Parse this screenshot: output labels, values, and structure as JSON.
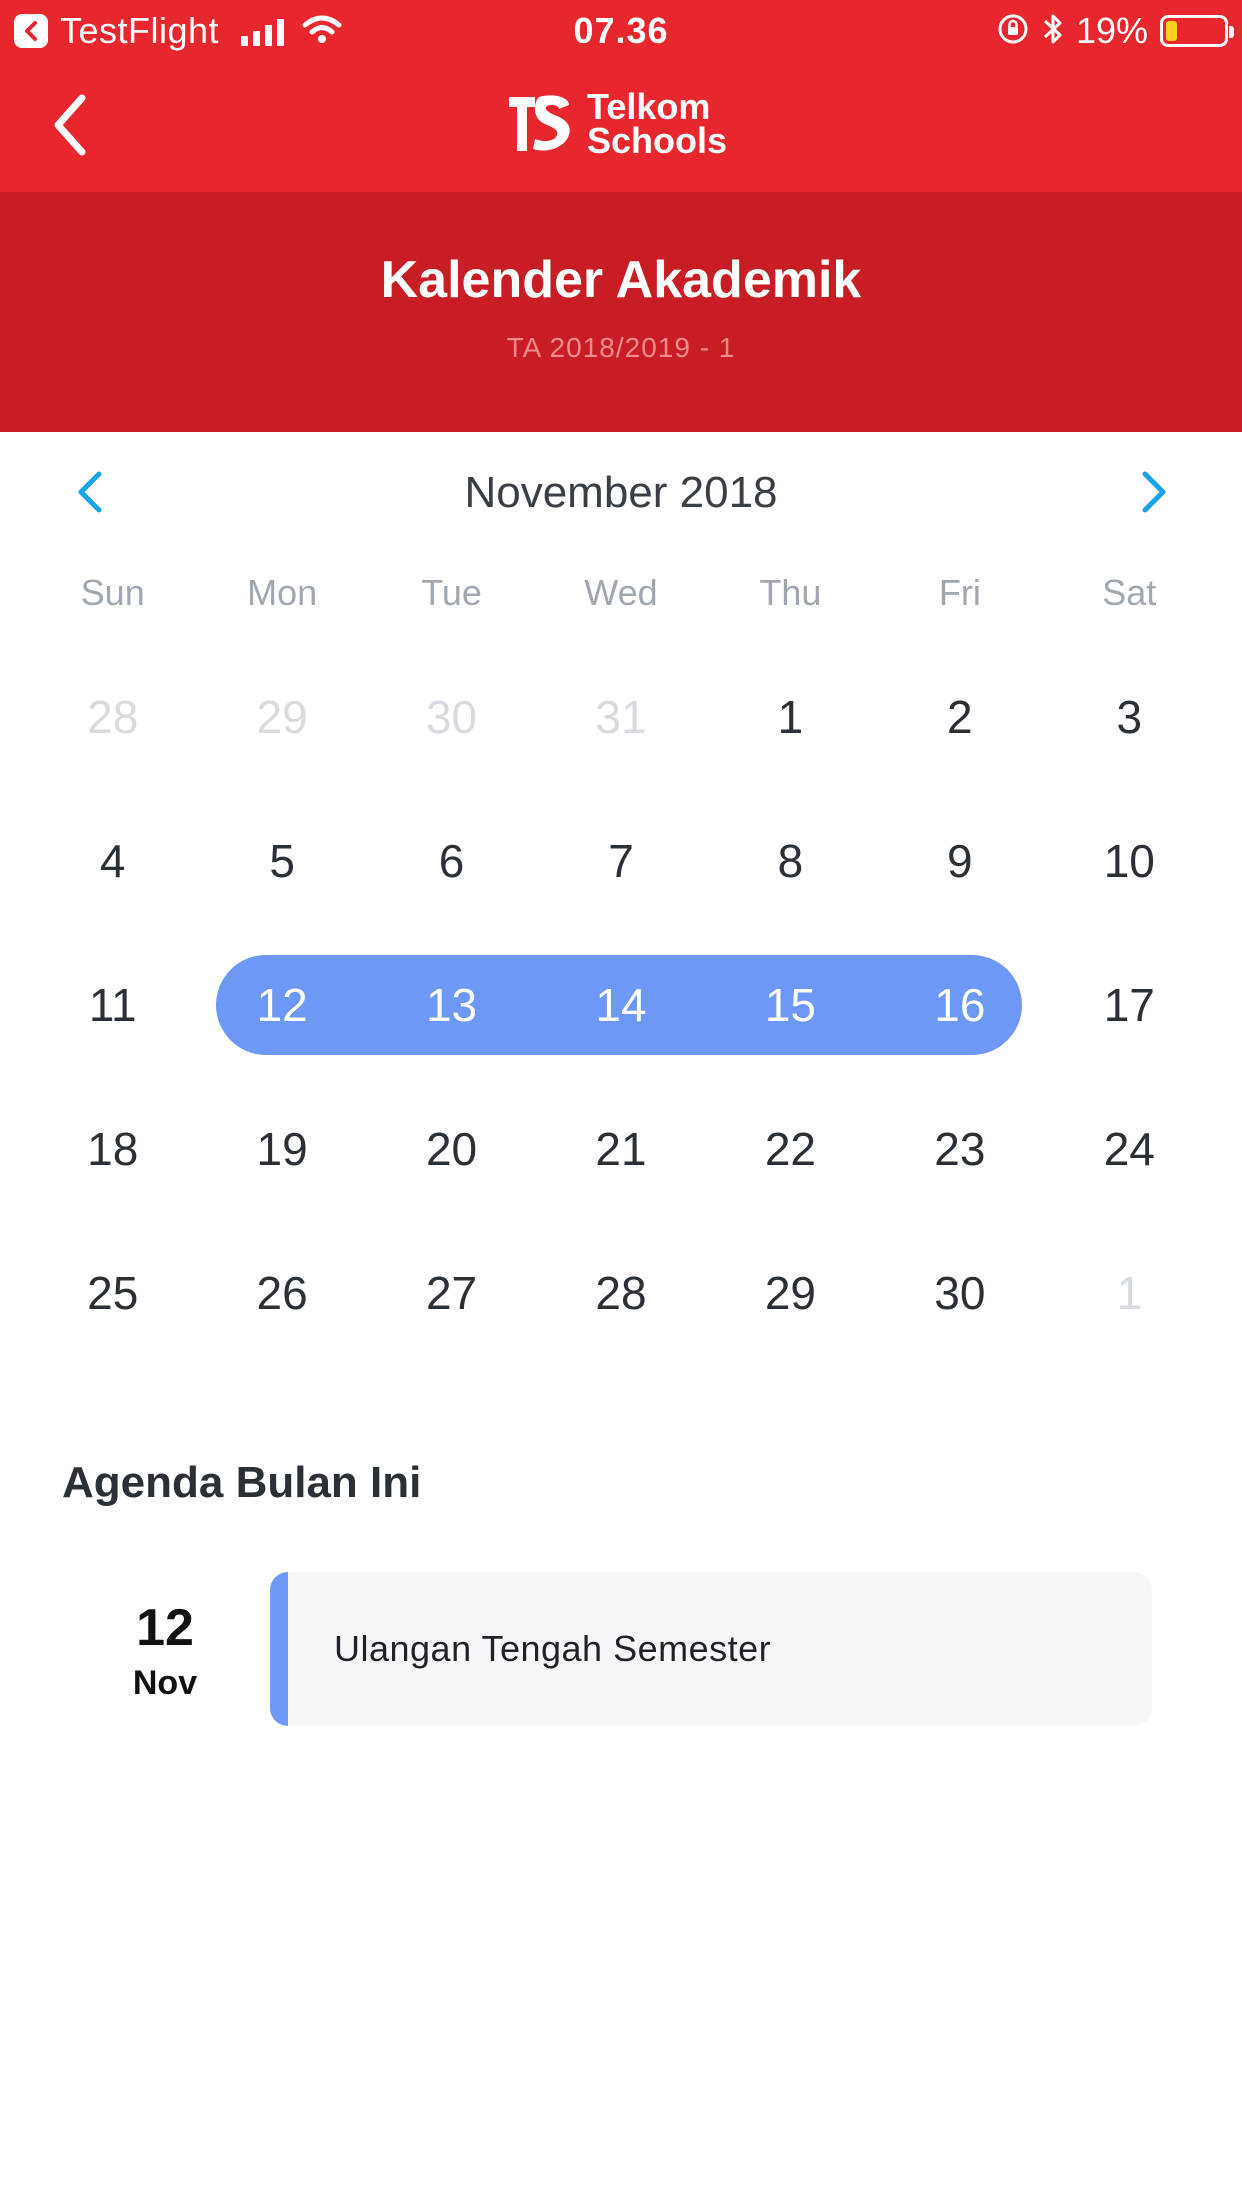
{
  "status_bar": {
    "app": "TestFlight",
    "time": "07.36",
    "battery_percent": "19%",
    "battery_level": 0.19
  },
  "nav": {
    "logo_line1": "Telkom",
    "logo_line2": "Schools"
  },
  "header": {
    "title": "Kalender Akademik",
    "subtitle": "TA 2018/2019 - 1"
  },
  "calendar": {
    "month": "November 2018",
    "weekdays": [
      "Sun",
      "Mon",
      "Tue",
      "Wed",
      "Thu",
      "Fri",
      "Sat"
    ],
    "days": [
      {
        "label": "28",
        "state": "muted"
      },
      {
        "label": "29",
        "state": "muted"
      },
      {
        "label": "30",
        "state": "muted"
      },
      {
        "label": "31",
        "state": "muted"
      },
      {
        "label": "1",
        "state": ""
      },
      {
        "label": "2",
        "state": ""
      },
      {
        "label": "3",
        "state": ""
      },
      {
        "label": "4",
        "state": ""
      },
      {
        "label": "5",
        "state": ""
      },
      {
        "label": "6",
        "state": ""
      },
      {
        "label": "7",
        "state": ""
      },
      {
        "label": "8",
        "state": ""
      },
      {
        "label": "9",
        "state": ""
      },
      {
        "label": "10",
        "state": ""
      },
      {
        "label": "11",
        "state": ""
      },
      {
        "label": "12",
        "state": "sel"
      },
      {
        "label": "13",
        "state": "sel"
      },
      {
        "label": "14",
        "state": "sel"
      },
      {
        "label": "15",
        "state": "sel"
      },
      {
        "label": "16",
        "state": "sel"
      },
      {
        "label": "17",
        "state": ""
      },
      {
        "label": "18",
        "state": ""
      },
      {
        "label": "19",
        "state": ""
      },
      {
        "label": "20",
        "state": ""
      },
      {
        "label": "21",
        "state": ""
      },
      {
        "label": "22",
        "state": ""
      },
      {
        "label": "23",
        "state": ""
      },
      {
        "label": "24",
        "state": ""
      },
      {
        "label": "25",
        "state": ""
      },
      {
        "label": "26",
        "state": ""
      },
      {
        "label": "27",
        "state": ""
      },
      {
        "label": "28",
        "state": ""
      },
      {
        "label": "29",
        "state": ""
      },
      {
        "label": "30",
        "state": ""
      },
      {
        "label": "1",
        "state": "muted"
      }
    ]
  },
  "agenda": {
    "title": "Agenda Bulan Ini",
    "items": [
      {
        "day": "12",
        "month": "Nov",
        "text": "Ulangan Tengah Semester"
      }
    ]
  },
  "colors": {
    "brand_red": "#e8262e",
    "header_red": "#c81d24",
    "accent_blue": "#6e98f5",
    "chevron_blue": "#1aa3e8"
  }
}
